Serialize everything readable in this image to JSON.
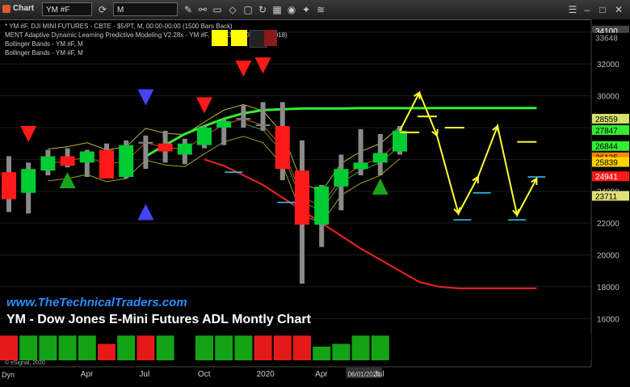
{
  "app": {
    "title": "Chart",
    "symbol": "YM #F",
    "interval": "M"
  },
  "info": {
    "line1": "* YM #F, DJI MINI FUTURES - CBTE - $5/PT, M, 00:00-00:00 (1500 Bars Back)",
    "line2": "MENT Adaptive Dynamic Learning Predictive Modeling V2.28x - YM #F, M (DEMO...",
    "line2b": "...ent, 0.003, 0.0018)",
    "line3": "Bollinger Bands - YM #F, M",
    "line4": "Bollinger Bands - YM #F, M"
  },
  "overlay": {
    "website": "www.TheTechnicalTraders.com",
    "headline": "YM - Dow Jones E-Mini Futures ADL Montly Chart",
    "copyright": "© eSignal, 2020"
  },
  "colors": {
    "up": "#00cc33",
    "down": "#ff1a1a",
    "doji": "#808080",
    "projection": "#ffff33",
    "tgt_cyan": "#33ccff",
    "ma_green": "#33ee33",
    "band_red": "#ee2222"
  },
  "chart_data": {
    "type": "candlestick",
    "ylim": [
      15000,
      34800
    ],
    "yticks": [
      16000,
      18000,
      20000,
      22000,
      24000,
      26000,
      28000,
      30000,
      32000,
      34000
    ],
    "xlabels": [
      {
        "label": "Apr",
        "i": 4
      },
      {
        "label": "Jul",
        "i": 7
      },
      {
        "label": "Oct",
        "i": 10
      },
      {
        "label": "2020",
        "i": 13
      },
      {
        "label": "Apr",
        "i": 16
      },
      {
        "label": "06/01/2020",
        "i": 18
      },
      {
        "label": "Jul",
        "i": 19
      }
    ],
    "candles": [
      {
        "o": 25200,
        "h": 26200,
        "l": 22700,
        "c": 23500
      },
      {
        "o": 23900,
        "h": 25800,
        "l": 22600,
        "c": 25400
      },
      {
        "o": 25300,
        "h": 26600,
        "l": 25000,
        "c": 26200
      },
      {
        "o": 26200,
        "h": 26700,
        "l": 25500,
        "c": 25600
      },
      {
        "o": 25800,
        "h": 26600,
        "l": 24900,
        "c": 26500
      },
      {
        "o": 26600,
        "h": 27000,
        "l": 25000,
        "c": 24800
      },
      {
        "o": 24900,
        "h": 27200,
        "l": 24800,
        "c": 26900
      },
      {
        "o": 27000,
        "h": 27500,
        "l": 25400,
        "c": 27100
      },
      {
        "o": 27000,
        "h": 27800,
        "l": 25800,
        "c": 26500
      },
      {
        "o": 26300,
        "h": 27300,
        "l": 25700,
        "c": 27000
      },
      {
        "o": 26900,
        "h": 28100,
        "l": 26700,
        "c": 28000
      },
      {
        "o": 28000,
        "h": 28500,
        "l": 26900,
        "c": 28400
      },
      {
        "o": 28500,
        "h": 29400,
        "l": 28000,
        "c": 28600
      },
      {
        "o": 28200,
        "h": 29600,
        "l": 27800,
        "c": 28100
      },
      {
        "o": 28100,
        "h": 29600,
        "l": 24700,
        "c": 25400
      },
      {
        "o": 25300,
        "h": 27200,
        "l": 18200,
        "c": 21900
      },
      {
        "o": 21900,
        "h": 24400,
        "l": 20500,
        "c": 24300
      },
      {
        "o": 24300,
        "h": 26300,
        "l": 22800,
        "c": 25400
      },
      {
        "o": 25400,
        "h": 27900,
        "l": 25000,
        "c": 25800
      },
      {
        "o": 25800,
        "h": 27600,
        "l": 25000,
        "c": 26400
      },
      {
        "o": 26500,
        "h": 28100,
        "l": 26300,
        "c": 27800
      }
    ],
    "bb_upper_green": [
      null,
      null,
      null,
      null,
      null,
      null,
      null,
      26200,
      26900,
      27600,
      28100,
      28550,
      28900,
      29100,
      29150,
      29200,
      29200,
      29200,
      29220,
      29220,
      29220,
      29220,
      29230,
      29230,
      29230,
      29230,
      29230,
      29230
    ],
    "band_red": [
      null,
      null,
      null,
      null,
      null,
      null,
      null,
      null,
      null,
      null,
      26000,
      25600,
      25000,
      24400,
      23600,
      22800,
      22000,
      21200,
      20400,
      19700,
      19000,
      18300,
      18000,
      17900,
      17900,
      17900,
      17900,
      17900
    ],
    "projection": [
      [
        20,
        27800
      ],
      [
        21,
        30200
      ],
      [
        21.9,
        27500
      ],
      [
        23,
        22600
      ],
      [
        24,
        24900
      ],
      [
        25,
        28100
      ],
      [
        26,
        22500
      ],
      [
        27,
        24800
      ]
    ],
    "projection_ticks": [
      [
        20.5,
        27700
      ],
      [
        21.4,
        28700
      ],
      [
        22.8,
        28000
      ],
      [
        26.5,
        27100
      ]
    ],
    "cyan_ticks": [
      [
        11.5,
        25200
      ],
      [
        14.2,
        23300
      ],
      [
        23.2,
        22200
      ],
      [
        24.2,
        23900
      ],
      [
        26,
        22200
      ],
      [
        27,
        24900
      ]
    ],
    "markers": [
      {
        "i": 1,
        "y": 27600,
        "dir": "down",
        "color": "#ff1a1a"
      },
      {
        "i": 3,
        "y": 24700,
        "dir": "up",
        "color": "#1aa31a"
      },
      {
        "i": 7,
        "y": 29900,
        "dir": "down",
        "color": "#4444ff"
      },
      {
        "i": 7,
        "y": 22700,
        "dir": "up",
        "color": "#4444ff"
      },
      {
        "i": 10,
        "y": 29400,
        "dir": "down",
        "color": "#ff1a1a"
      },
      {
        "i": 12,
        "y": 31700,
        "dir": "down",
        "color": "#ff1a1a"
      },
      {
        "i": 13,
        "y": 31900,
        "dir": "down",
        "color": "#ff1a1a"
      },
      {
        "i": 19,
        "y": 24300,
        "dir": "up",
        "color": "#1aa31a"
      }
    ],
    "price_tags": [
      {
        "value": "34100",
        "y": 34100,
        "bg": "#444444",
        "fg": "#ffffff"
      },
      {
        "value": "33648",
        "y": 33648,
        "bg": "#000000",
        "fg": "#aaaaaa"
      },
      {
        "value": "28559",
        "y": 28559,
        "bg": "#d6e06a",
        "fg": "#000000"
      },
      {
        "value": "27847",
        "y": 27847,
        "bg": "#33ee33",
        "fg": "#000000"
      },
      {
        "value": "26844",
        "y": 26844,
        "bg": "#33ee33",
        "fg": "#000000"
      },
      {
        "value": "26135",
        "y": 26135,
        "bg": "#ff8800",
        "fg": "#000000"
      },
      {
        "value": "25839",
        "y": 25839,
        "bg": "#ffd400",
        "fg": "#000000"
      },
      {
        "value": "24941",
        "y": 24941,
        "bg": "#ff1a1a",
        "fg": "#ffffff"
      },
      {
        "value": "23711",
        "y": 23711,
        "bg": "#e0e07a",
        "fg": "#000000"
      }
    ],
    "volume": [
      {
        "v": 0.9,
        "up": false
      },
      {
        "v": 0.9,
        "up": true
      },
      {
        "v": 0.9,
        "up": true
      },
      {
        "v": 0.9,
        "up": true
      },
      {
        "v": 0.9,
        "up": true
      },
      {
        "v": 0.6,
        "up": false
      },
      {
        "v": 0.9,
        "up": true
      },
      {
        "v": 0.9,
        "up": false
      },
      {
        "v": 0.9,
        "up": true
      },
      {
        "v": 0.0,
        "up": true
      },
      {
        "v": 0.9,
        "up": true
      },
      {
        "v": 0.9,
        "up": true
      },
      {
        "v": 0.9,
        "up": true
      },
      {
        "v": 0.9,
        "up": false
      },
      {
        "v": 0.9,
        "up": false
      },
      {
        "v": 0.9,
        "up": false
      },
      {
        "v": 0.5,
        "up": true
      },
      {
        "v": 0.6,
        "up": true
      },
      {
        "v": 0.9,
        "up": true
      },
      {
        "v": 0.9,
        "up": true
      }
    ]
  }
}
